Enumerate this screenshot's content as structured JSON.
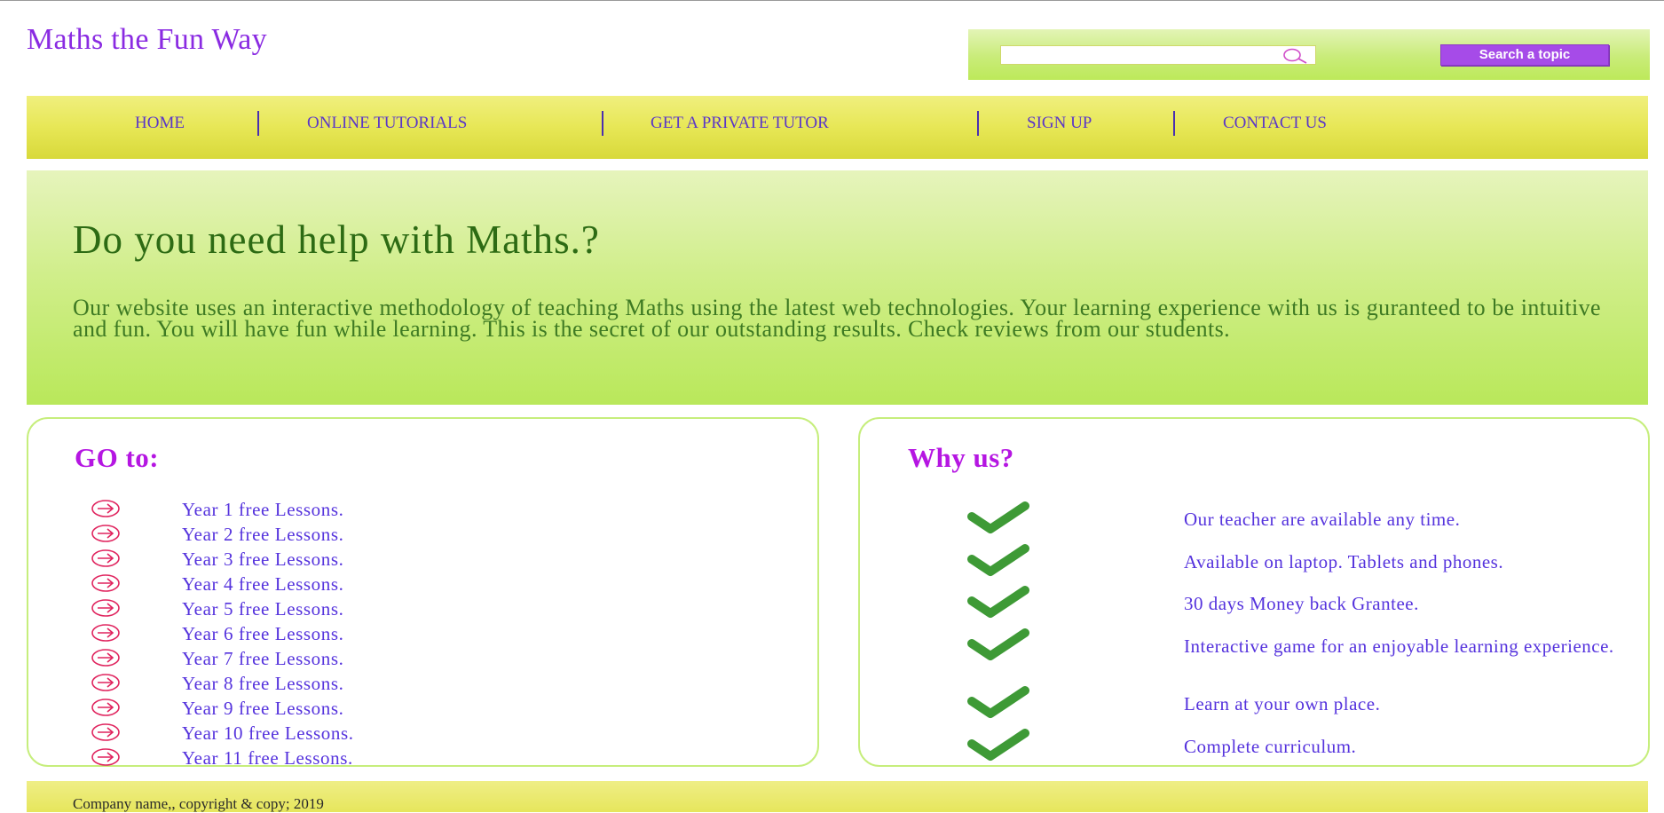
{
  "site": {
    "title": "Maths the Fun Way"
  },
  "search": {
    "placeholder": "",
    "value": "",
    "button_label": "Search a topic"
  },
  "nav": {
    "items": [
      {
        "label": "HOME"
      },
      {
        "label": "ONLINE TUTORIALS"
      },
      {
        "label": "GET A PRIVATE TUTOR"
      },
      {
        "label": "SIGN UP"
      },
      {
        "label": "CONTACT US"
      }
    ]
  },
  "hero": {
    "heading": "Do you need help with Maths.?",
    "text": "Our website uses an interactive methodology of teaching Maths using the latest web technologies. Your learning experience with us is guranteed to be intuitive and fun. You will have fun while learning. This is the secret of our outstanding results. Check reviews from our students."
  },
  "goto": {
    "heading": "GO to:",
    "items": [
      {
        "label": "Year 1 free Lessons."
      },
      {
        "label": "Year 2 free Lessons."
      },
      {
        "label": "Year 3 free Lessons."
      },
      {
        "label": "Year 4 free Lessons."
      },
      {
        "label": "Year 5 free Lessons."
      },
      {
        "label": "Year 6 free Lessons."
      },
      {
        "label": "Year 7 free Lessons."
      },
      {
        "label": "Year 8 free Lessons."
      },
      {
        "label": "Year 9 free Lessons."
      },
      {
        "label": "Year 10 free Lessons."
      },
      {
        "label": "Year 11 free Lessons."
      }
    ],
    "icon": "arrow-right-circle-icon"
  },
  "why": {
    "heading": "Why us?",
    "items": [
      {
        "label": "Our teacher are available any time."
      },
      {
        "label": "Available on laptop. Tablets and phones."
      },
      {
        "label": "30 days Money back Grantee."
      },
      {
        "label": "Interactive game for an enjoyable learning experience."
      },
      {
        "label": "Learn at your own place."
      },
      {
        "label": "Complete curriculum."
      }
    ],
    "icon": "check-icon"
  },
  "footer": {
    "text": "Company name,, copyright & copy; 2019"
  },
  "colors": {
    "brand_purple": "#8a2be2",
    "link_blue": "#5533dd",
    "heading_magenta": "#b516e2",
    "hero_green_text": "#2d6b14",
    "nav_yellow": "#e7e756",
    "hero_green_bg": "#c9ec79",
    "check_green": "#3e9a36",
    "icon_pink": "#e0245e"
  }
}
